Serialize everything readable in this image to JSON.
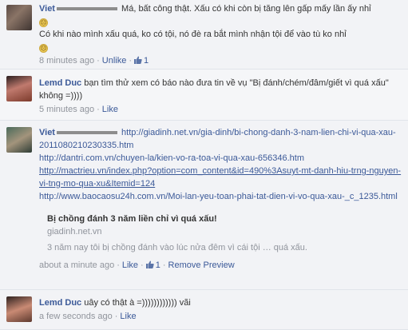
{
  "comments": [
    {
      "name": "Viet",
      "lines": [
        "Má, bất công thật. Xấu có khi còn bị tăng lên gấp mấy lần ấy nhỉ",
        "Có khi nào mình xấu quá, ko có tội, nó đè ra bắt mình nhận tội để vào tù ko nhỉ"
      ],
      "time": "8 minutes ago",
      "unlike": "Unlike",
      "likes": "1"
    },
    {
      "name": "Lemd Duc",
      "text": "bạn tìm thử xem có báo nào đưa tin về vụ \"Bị đánh/chém/đâm/giết vì quá xấu\" không =))))",
      "time": "5 minutes ago",
      "like": "Like"
    },
    {
      "name": "Viet",
      "links": [
        "http://giadinh.net.vn/gia-dinh/bi-chong-danh-3-nam-lien-chi-vi-qua-xau-20110802102303​35.htm",
        "http://dantri.com.vn/chuyen-la/kien-vo-ra-toa-vi-qua-xau-656346.htm",
        "http://mactrieu.vn/index.php?option=com_content&id=490%3Asuyt-mt-danh-hiu-trng-nguyen-vi-tng-mo-qua-xu&Itemid=124",
        "http://www.baocaosu24h.com.vn/Moi-lan-yeu-toan-phai-tat-dien-vi-vo-qua-xau-_c_1235.html"
      ],
      "preview_title": "Bị chồng đánh 3 năm liền chỉ vì quá xấu!",
      "preview_domain": "giadinh.net.vn",
      "preview_desc": "3 năm nay tôi bị chồng đánh vào lúc nửa đêm vì cái tội … quá xấu.",
      "time": "about a minute ago",
      "like": "Like",
      "likes": "1",
      "remove_preview": "Remove Preview"
    },
    {
      "name": "Lemd Duc",
      "text": "uây có thật à =)))))))))))) vãi",
      "time": "a few seconds ago",
      "like": "Like"
    }
  ],
  "colors": {
    "link": "#3b5998",
    "meta": "#90949c",
    "background": "#f2f3f6"
  }
}
